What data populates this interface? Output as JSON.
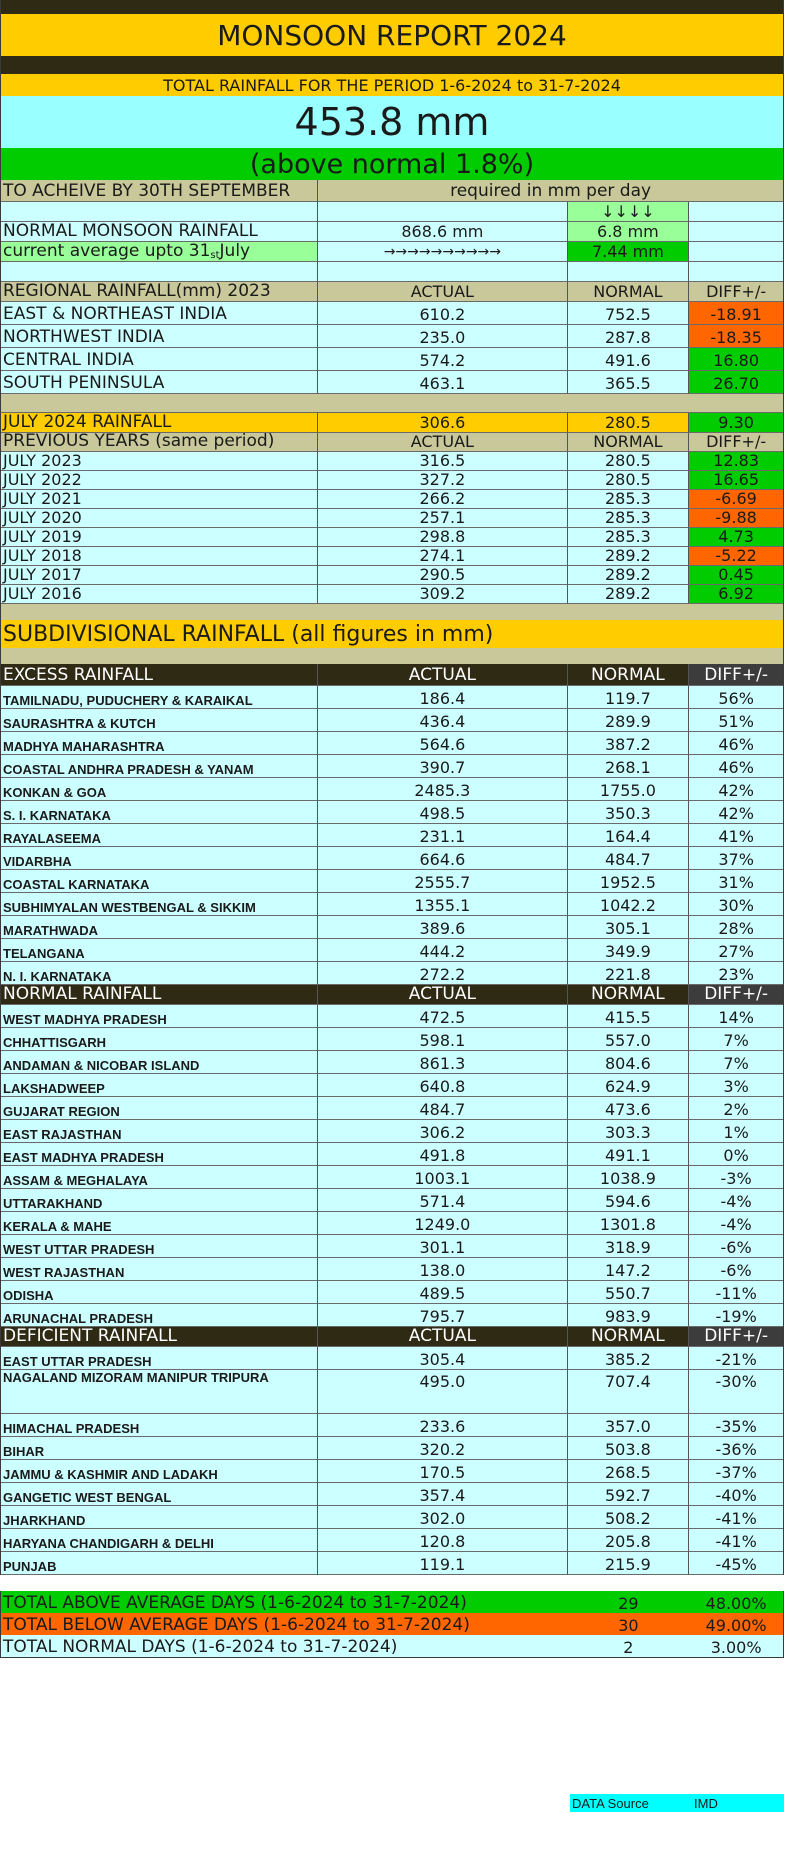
{
  "title": "MONSOON REPORT 2024",
  "period_label": "TOTAL RAINFALL FOR THE PERIOD 1-6-2024 to 31-7-2024",
  "total_rainfall": "453.8 mm",
  "status": "(above normal 1.8%)",
  "achieve": {
    "label": "TO ACHEIVE BY 30TH SEPTEMBER",
    "required_label": "required in mm per day",
    "down_arrows": "↓↓↓↓",
    "normal_label": "NORMAL MONSOON RAINFALL",
    "normal_value": "868.6 mm",
    "normal_per_day": "6.8 mm",
    "current_label_pre": "current average upto 31",
    "current_label_sup": "st",
    "current_label_post": " July",
    "right_arrows": "→→→→→→→→→→",
    "current_per_day": "7.44 mm"
  },
  "regional": {
    "header": [
      "REGIONAL RAINFALL(mm) 2023",
      "ACTUAL",
      "NORMAL",
      "DIFF+/-"
    ],
    "rows": [
      {
        "name": "EAST & NORTHEAST INDIA",
        "actual": "610.2",
        "normal": "752.5",
        "diff": "-18.91",
        "color": "#ff6600"
      },
      {
        "name": "NORTHWEST INDIA",
        "actual": "235.0",
        "normal": "287.8",
        "diff": "-18.35",
        "color": "#ff6600"
      },
      {
        "name": "CENTRAL INDIA",
        "actual": "574.2",
        "normal": "491.6",
        "diff": "16.80",
        "color": "#00cc00"
      },
      {
        "name": "SOUTH PENINSULA",
        "actual": "463.1",
        "normal": "365.5",
        "diff": "26.70",
        "color": "#00cc00"
      }
    ]
  },
  "july2024": {
    "name": "JULY 2024 RAINFALL",
    "actual": "306.6",
    "normal": "280.5",
    "diff": "9.30"
  },
  "previous": {
    "header": [
      "PREVIOUS YEARS (same period)",
      "ACTUAL",
      "NORMAL",
      "DIFF+/-"
    ],
    "rows": [
      {
        "name": "JULY 2023",
        "actual": "316.5",
        "normal": "280.5",
        "diff": "12.83",
        "color": "#00cc00"
      },
      {
        "name": "JULY 2022",
        "actual": "327.2",
        "normal": "280.5",
        "diff": "16.65",
        "color": "#00cc00"
      },
      {
        "name": "JULY 2021",
        "actual": "266.2",
        "normal": "285.3",
        "diff": "-6.69",
        "color": "#ff6600"
      },
      {
        "name": "JULY 2020",
        "actual": "257.1",
        "normal": "285.3",
        "diff": "-9.88",
        "color": "#ff6600"
      },
      {
        "name": "JULY 2019",
        "actual": "298.8",
        "normal": "285.3",
        "diff": "4.73",
        "color": "#00cc00"
      },
      {
        "name": "JULY 2018",
        "actual": "274.1",
        "normal": "289.2",
        "diff": "-5.22",
        "color": "#ff6600"
      },
      {
        "name": "JULY 2017",
        "actual": "290.5",
        "normal": "289.2",
        "diff": "0.45",
        "color": "#00cc00"
      },
      {
        "name": "JULY 2016",
        "actual": "309.2",
        "normal": "289.2",
        "diff": "6.92",
        "color": "#00cc00"
      }
    ]
  },
  "subdivisional_title": "SUBDIVISIONAL RAINFALL (all figures in mm)",
  "excess": {
    "header": [
      "EXCESS RAINFALL",
      "ACTUAL",
      "NORMAL",
      "DIFF+/-"
    ],
    "rows": [
      {
        "name": "TAMILNADU, PUDUCHERY & KARAIKAL",
        "actual": "186.4",
        "normal": "119.7",
        "diff": "56%"
      },
      {
        "name": "SAURASHTRA & KUTCH",
        "actual": "436.4",
        "normal": "289.9",
        "diff": "51%"
      },
      {
        "name": "MADHYA MAHARASHTRA",
        "actual": "564.6",
        "normal": "387.2",
        "diff": "46%"
      },
      {
        "name": "COASTAL ANDHRA PRADESH & YANAM",
        "actual": "390.7",
        "normal": "268.1",
        "diff": "46%"
      },
      {
        "name": "KONKAN & GOA",
        "actual": "2485.3",
        "normal": "1755.0",
        "diff": "42%"
      },
      {
        "name": "S. I. KARNATAKA",
        "actual": "498.5",
        "normal": "350.3",
        "diff": "42%"
      },
      {
        "name": "RAYALASEEMA",
        "actual": "231.1",
        "normal": "164.4",
        "diff": "41%"
      },
      {
        "name": "VIDARBHA",
        "actual": "664.6",
        "normal": "484.7",
        "diff": "37%"
      },
      {
        "name": "COASTAL KARNATAKA",
        "actual": "2555.7",
        "normal": "1952.5",
        "diff": "31%"
      },
      {
        "name": "SUBHIMYALAN WESTBENGAL & SIKKIM",
        "actual": "1355.1",
        "normal": "1042.2",
        "diff": "30%"
      },
      {
        "name": "MARATHWADA",
        "actual": "389.6",
        "normal": "305.1",
        "diff": "28%"
      },
      {
        "name": "TELANGANA",
        "actual": "444.2",
        "normal": "349.9",
        "diff": "27%"
      },
      {
        "name": "N. I. KARNATAKA",
        "actual": "272.2",
        "normal": "221.8",
        "diff": "23%"
      }
    ]
  },
  "normal_rain": {
    "header": [
      "NORMAL RAINFALL",
      "ACTUAL",
      "NORMAL",
      "DIFF+/-"
    ],
    "rows": [
      {
        "name": "WEST MADHYA PRADESH",
        "actual": "472.5",
        "normal": "415.5",
        "diff": "14%"
      },
      {
        "name": "CHHATTISGARH",
        "actual": "598.1",
        "normal": "557.0",
        "diff": "7%"
      },
      {
        "name": "ANDAMAN & NICOBAR ISLAND",
        "actual": "861.3",
        "normal": "804.6",
        "diff": "7%"
      },
      {
        "name": "LAKSHADWEEP",
        "actual": "640.8",
        "normal": "624.9",
        "diff": "3%"
      },
      {
        "name": "GUJARAT REGION",
        "actual": "484.7",
        "normal": "473.6",
        "diff": "2%"
      },
      {
        "name": "EAST RAJASTHAN",
        "actual": "306.2",
        "normal": "303.3",
        "diff": "1%"
      },
      {
        "name": "EAST MADHYA PRADESH",
        "actual": "491.8",
        "normal": "491.1",
        "diff": "0%"
      },
      {
        "name": "ASSAM & MEGHALAYA",
        "actual": "1003.1",
        "normal": "1038.9",
        "diff": "-3%"
      },
      {
        "name": "UTTARAKHAND",
        "actual": "571.4",
        "normal": "594.6",
        "diff": "-4%"
      },
      {
        "name": "KERALA & MAHE",
        "actual": "1249.0",
        "normal": "1301.8",
        "diff": "-4%"
      },
      {
        "name": "WEST UTTAR PRADESH",
        "actual": "301.1",
        "normal": "318.9",
        "diff": "-6%"
      },
      {
        "name": "WEST RAJASTHAN",
        "actual": "138.0",
        "normal": "147.2",
        "diff": "-6%"
      },
      {
        "name": "ODISHA",
        "actual": "489.5",
        "normal": "550.7",
        "diff": "-11%"
      },
      {
        "name": "ARUNACHAL PRADESH",
        "actual": "795.7",
        "normal": "983.9",
        "diff": "-19%"
      }
    ]
  },
  "deficient": {
    "header": [
      "DEFICIENT RAINFALL",
      "ACTUAL",
      "NORMAL",
      "DIFF+/-"
    ],
    "rows": [
      {
        "name": "EAST UTTAR PRADESH",
        "actual": "305.4",
        "normal": "385.2",
        "diff": "-21%"
      },
      {
        "name": "NAGALAND MIZORAM MANIPUR TRIPURA",
        "actual": "495.0",
        "normal": "707.4",
        "diff": "-30%",
        "tall": true
      },
      {
        "name": "HIMACHAL PRADESH",
        "actual": "233.6",
        "normal": "357.0",
        "diff": "-35%"
      },
      {
        "name": "BIHAR",
        "actual": "320.2",
        "normal": "503.8",
        "diff": "-36%"
      },
      {
        "name": "JAMMU & KASHMIR AND LADAKH",
        "actual": "170.5",
        "normal": "268.5",
        "diff": "-37%"
      },
      {
        "name": "GANGETIC WEST BENGAL",
        "actual": "357.4",
        "normal": "592.7",
        "diff": "-40%"
      },
      {
        "name": "JHARKHAND",
        "actual": "302.0",
        "normal": "508.2",
        "diff": "-41%"
      },
      {
        "name": "HARYANA CHANDIGARH & DELHI",
        "actual": "120.8",
        "normal": "205.8",
        "diff": "-41%"
      },
      {
        "name": "PUNJAB",
        "actual": "119.1",
        "normal": "215.9",
        "diff": "-45%"
      }
    ]
  },
  "totals": [
    {
      "label": "TOTAL ABOVE AVERAGE DAYS (1-6-2024 to 31-7-2024)",
      "days": "29",
      "pct": "48.00%",
      "color": "#00cc00"
    },
    {
      "label": "TOTAL BELOW AVERAGE DAYS (1-6-2024 to 31-7-2024)",
      "days": "30",
      "pct": "49.00%",
      "color": "#ff6600"
    },
    {
      "label": "TOTAL NORMAL DAYS (1-6-2024 to 31-7-2024)",
      "days": "2",
      "pct": "3.00%",
      "color": "#ccffff"
    }
  ],
  "source": {
    "label": "DATA Source",
    "value": "IMD"
  }
}
